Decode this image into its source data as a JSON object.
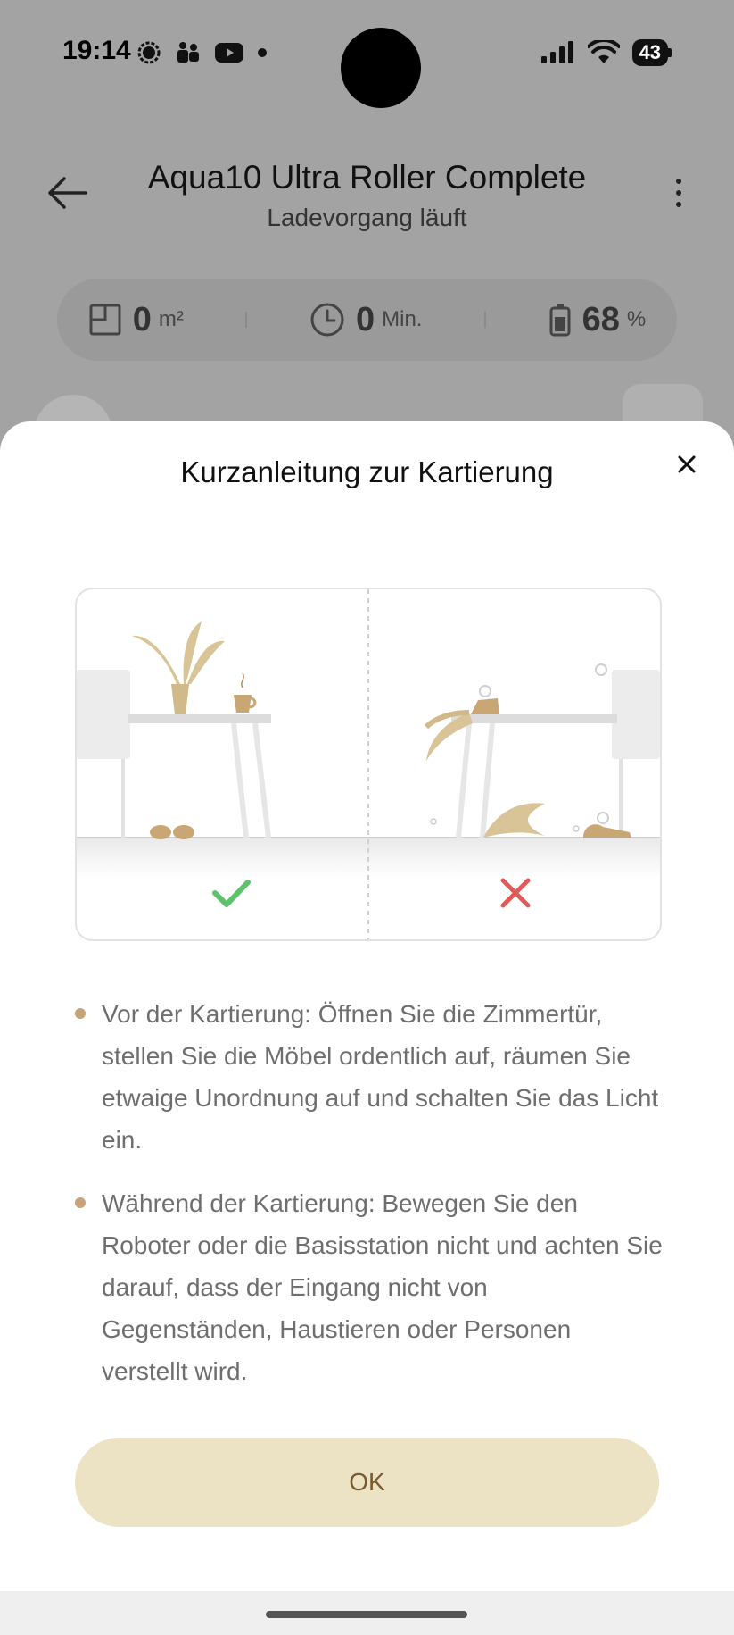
{
  "status_bar": {
    "time": "19:14",
    "battery_level": "43",
    "icons_left": [
      "signal-chat-icon",
      "teams-icon",
      "youtube-icon",
      "dot-icon"
    ],
    "icons_right": [
      "cellular-signal-icon",
      "wifi-icon",
      "battery-icon"
    ]
  },
  "header": {
    "title": "Aqua10 Ultra Roller Complete",
    "subtitle": "Ladevorgang läuft"
  },
  "stats": [
    {
      "icon": "area-icon",
      "value": "0",
      "unit": "m²"
    },
    {
      "icon": "clock-icon",
      "value": "0",
      "unit": "Min."
    },
    {
      "icon": "battery-icon",
      "value": "68",
      "unit": "%"
    }
  ],
  "sheet": {
    "title": "Kurzanleitung zur Kartierung",
    "bullets": [
      "Vor der Kartierung: Öffnen Sie die Zimmertür, stellen Sie die Möbel ordentlich auf, räumen Sie etwaige Unordnung auf und schalten Sie das Licht ein.",
      "Während der Kartierung: Bewegen Sie den Roboter oder die Basisstation nicht und achten Sie darauf, dass der Eingang nicht von Gegenständen, Haustieren oder Personen verstellt wird."
    ],
    "ok_label": "OK"
  },
  "colors": {
    "accent_dot": "#c7a37a",
    "ok_bg": "#ece3c4",
    "ok_text": "#7a5a2c",
    "check": "#5cc26c",
    "cross": "#e05a5a"
  }
}
